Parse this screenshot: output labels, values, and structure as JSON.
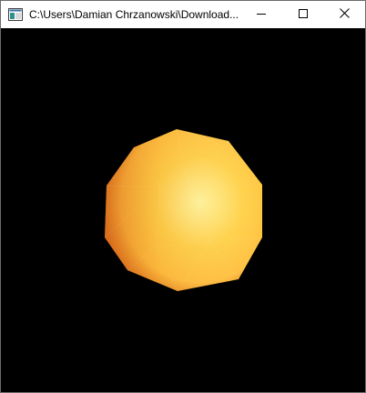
{
  "window": {
    "title": "C:\\Users\\Damian Chrzanowski\\Download...",
    "icon": "console-app-icon",
    "buttons": {
      "minimize": "minimize-icon",
      "maximize": "maximize-icon",
      "close": "close-icon"
    }
  },
  "scene": {
    "background_color": "#000000",
    "object": "shaded-polyhedron-sphere",
    "colors": {
      "highlight": "#fff6a0",
      "mid": "#ffc040",
      "shadow": "#e07a20"
    }
  }
}
